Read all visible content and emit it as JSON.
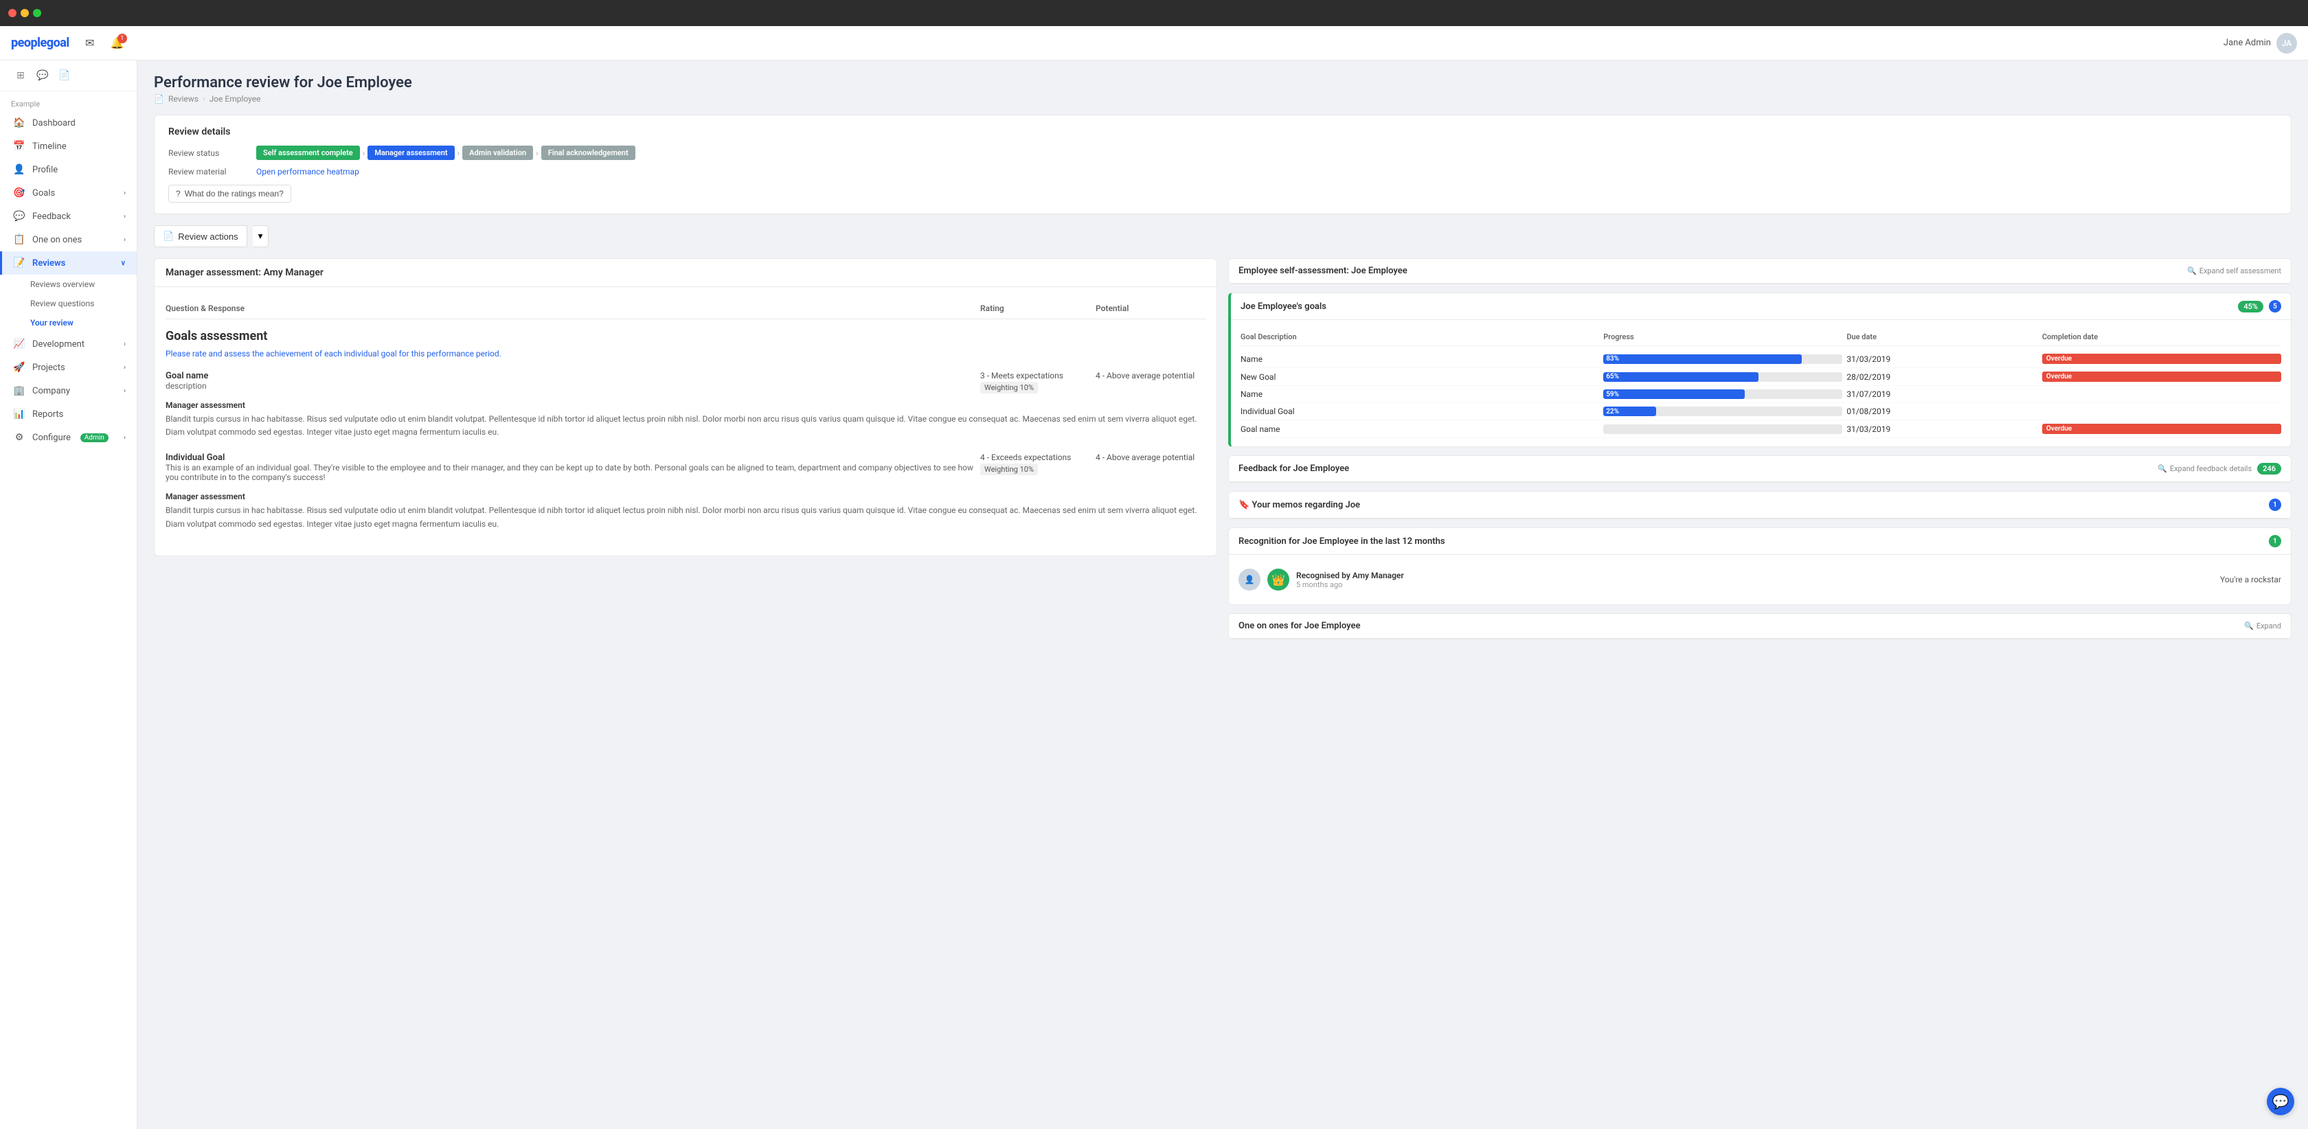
{
  "topbar": {
    "dots": [
      "red",
      "yellow",
      "green"
    ]
  },
  "header": {
    "logo": "peoplegoal",
    "icons": [
      {
        "name": "mail-icon",
        "symbol": "✉"
      },
      {
        "name": "notification-icon",
        "symbol": "🔔",
        "badge": "1"
      }
    ],
    "user": {
      "name": "Jane Admin",
      "avatar_initials": "JA"
    }
  },
  "sidebar": {
    "section_label": "Example",
    "icon_buttons": [
      {
        "name": "grid-icon",
        "symbol": "⊞"
      },
      {
        "name": "chat-icon",
        "symbol": "💬"
      },
      {
        "name": "document-icon",
        "symbol": "📄"
      }
    ],
    "items": [
      {
        "id": "dashboard",
        "label": "Dashboard",
        "icon": "🏠",
        "active": false
      },
      {
        "id": "timeline",
        "label": "Timeline",
        "icon": "📅",
        "active": false
      },
      {
        "id": "profile",
        "label": "Profile",
        "icon": "👤",
        "active": false
      },
      {
        "id": "goals",
        "label": "Goals",
        "icon": "🎯",
        "active": false,
        "has_arrow": true
      },
      {
        "id": "feedback",
        "label": "Feedback",
        "icon": "💬",
        "active": false,
        "has_arrow": true
      },
      {
        "id": "one-on-ones",
        "label": "One on ones",
        "icon": "📋",
        "active": false,
        "has_arrow": true
      },
      {
        "id": "reviews",
        "label": "Reviews",
        "icon": "📝",
        "active": true,
        "has_arrow": true
      },
      {
        "id": "development",
        "label": "Development",
        "icon": "📈",
        "active": false,
        "has_arrow": true
      },
      {
        "id": "projects",
        "label": "Projects",
        "icon": "🚀",
        "active": false,
        "has_arrow": true
      },
      {
        "id": "company",
        "label": "Company",
        "icon": "🏢",
        "active": false,
        "has_arrow": true
      },
      {
        "id": "reports",
        "label": "Reports",
        "icon": "📊",
        "active": false,
        "has_arrow": false
      },
      {
        "id": "configure",
        "label": "Configure",
        "icon": "⚙",
        "active": false,
        "badge": "Admin"
      }
    ],
    "reviews_sub": [
      {
        "id": "reviews-overview",
        "label": "Reviews overview",
        "active": false
      },
      {
        "id": "review-questions",
        "label": "Review questions",
        "active": false
      },
      {
        "id": "your-review",
        "label": "Your review",
        "active": true
      }
    ]
  },
  "page": {
    "title": "Performance review for Joe Employee",
    "breadcrumb": [
      "Reviews",
      "Joe Employee"
    ]
  },
  "review_details": {
    "section_title": "Review details",
    "status_label": "Review status",
    "statuses": [
      {
        "label": "Self assessment complete",
        "color": "green"
      },
      {
        "label": "Manager assessment",
        "color": "blue"
      },
      {
        "label": "Admin validation",
        "color": "gray"
      },
      {
        "label": "Final acknowledgement",
        "color": "gray"
      }
    ],
    "material_label": "Review material",
    "material_link": "Open performance heatmap",
    "ratings_btn": "What do the ratings mean?"
  },
  "action_bar": {
    "review_actions_label": "Review actions"
  },
  "manager_panel": {
    "header": "Manager assessment: Amy Manager",
    "columns": [
      "Question & Response",
      "Rating",
      "Potential"
    ],
    "goals_title": "Goals assessment",
    "goals_desc": "Please rate and assess the achievement of each individual goal for this performance period.",
    "goals": [
      {
        "name": "Goal name",
        "description": "description",
        "rating": "3 - Meets expectations",
        "potential": "4 - Above average potential",
        "weighting": "10%",
        "assessment_label": "Manager assessment",
        "assessment_text": "Blandit turpis cursus in hac habitasse. Risus sed vulputate odio ut enim blandit volutpat. Pellentesque id nibh tortor id aliquet lectus proin nibh nisl. Dolor morbi non arcu risus quis varius quam quisque id. Vitae congue eu consequat ac. Maecenas sed enim ut sem viverra aliquot eget. Diam volutpat commodo sed egestas. Integer vitae justo eget magna fermentum iaculis eu."
      },
      {
        "name": "Individual Goal",
        "description": "This is an example of an individual goal. They're visible to the employee and to their manager, and they can be kept up to date by both. Personal goals can be aligned to team, department and company objectives to see how you contribute in to the company's success!",
        "rating": "4 - Exceeds expectations",
        "potential": "4 - Above average potential",
        "weighting": "10%",
        "assessment_label": "Manager assessment",
        "assessment_text": "Blandit turpis cursus in hac habitasse. Risus sed vulputate odio ut enim blandit volutpat. Pellentesque id nibh tortor id aliquet lectus proin nibh nisl. Dolor morbi non arcu risus quis varius quam quisque id. Vitae congue eu consequat ac. Maecenas sed enim ut sem viverra aliquot eget. Diam volutpat commodo sed egestas. Integer vitae justo eget magna fermentum iaculis eu."
      }
    ]
  },
  "right_panels": {
    "self_assessment": {
      "header": "Employee self-assessment: Joe Employee",
      "expand_label": "Expand self assessment"
    },
    "goals": {
      "header": "Joe Employee's goals",
      "percent": "45%",
      "count": 5,
      "columns": [
        "Goal Description",
        "Progress",
        "Due date",
        "Completion date"
      ],
      "rows": [
        {
          "name": "Name",
          "progress": 83,
          "color": "#2563eb",
          "due": "31/03/2019",
          "completion": "",
          "overdue": true
        },
        {
          "name": "New Goal",
          "progress": 65,
          "color": "#2563eb",
          "due": "28/02/2019",
          "completion": "",
          "overdue": true
        },
        {
          "name": "Name",
          "progress": 59,
          "color": "#2563eb",
          "due": "31/07/2019",
          "completion": "",
          "overdue": false
        },
        {
          "name": "Individual Goal",
          "progress": 22,
          "color": "#2563eb",
          "due": "01/08/2019",
          "completion": "",
          "overdue": false
        },
        {
          "name": "Goal name",
          "progress": 0,
          "color": "#ccc",
          "due": "31/03/2019",
          "completion": "",
          "overdue": true
        }
      ]
    },
    "feedback": {
      "header": "Feedback for Joe Employee",
      "expand_label": "Expand feedback details",
      "count": 246
    },
    "memos": {
      "header": "Your memos regarding Joe",
      "count": 1
    },
    "recognition": {
      "header": "Recognition for Joe Employee in the last 12 months",
      "count": 1,
      "items": [
        {
          "by": "Recognised by Amy Manager",
          "time": "5 months ago",
          "message": "You're a rockstar"
        }
      ]
    },
    "one_on_ones": {
      "header": "One on ones for Joe Employee",
      "expand_label": "Expand"
    }
  }
}
